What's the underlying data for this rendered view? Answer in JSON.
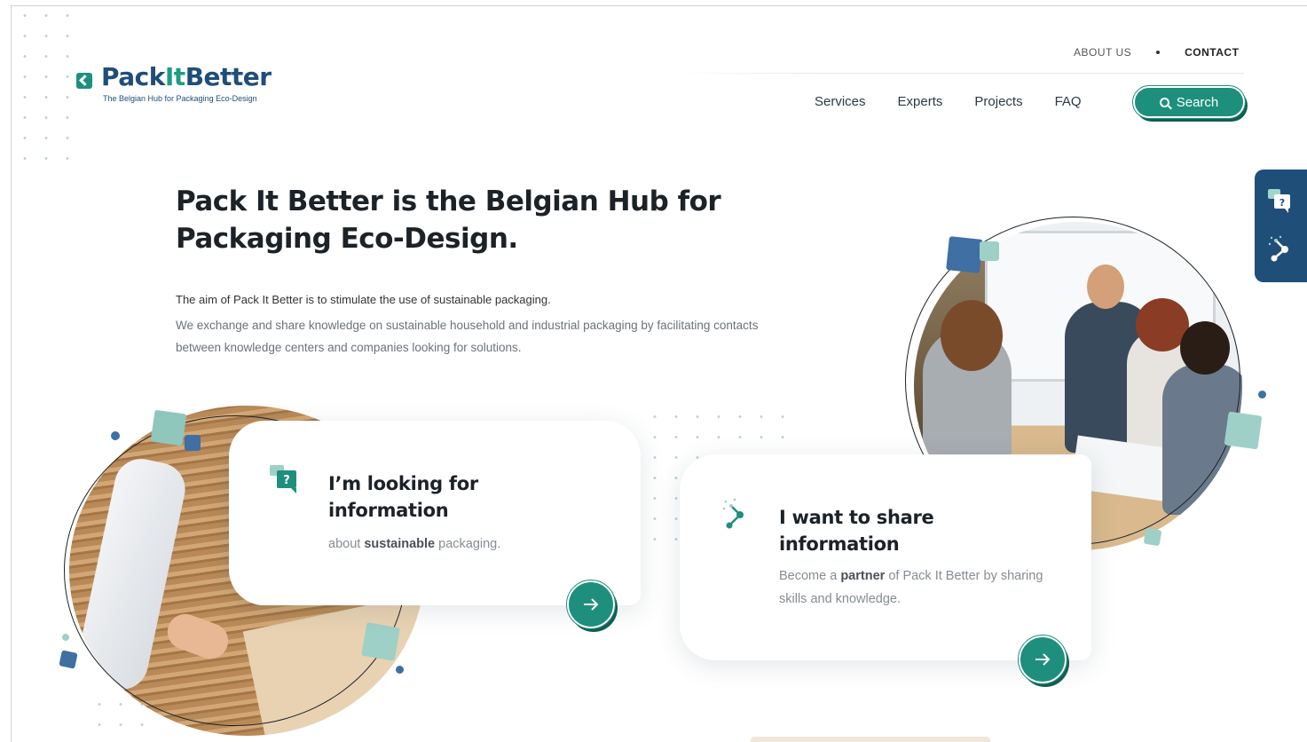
{
  "brand": {
    "name_part1": "Pack",
    "name_part2": "It",
    "name_part3": "Better",
    "tagline": "The Belgian Hub for Packaging Eco-Design",
    "primary_color": "#1f4e79",
    "accent_color": "#1e8f7c"
  },
  "topnav": {
    "about": "ABOUT US",
    "contact": "CONTACT"
  },
  "mainnav": {
    "items": [
      "Services",
      "Experts",
      "Projects",
      "FAQ"
    ],
    "search_label": "Search"
  },
  "side_widget": {
    "icons": [
      "question-chat-icon",
      "share-nodes-icon"
    ]
  },
  "hero": {
    "title": "Pack It Better is the Belgian Hub for Packaging Eco-Design.",
    "lead": "The aim of Pack It Better is to stimulate the use of sustainable packaging.",
    "body": "We exchange and share knowledge on sustainable household and industrial packaging by facilitating contacts between knowledge centers and companies looking for solutions."
  },
  "cards": [
    {
      "title": "I’m looking for information",
      "text_before": "about ",
      "text_bold": "sustainable",
      "text_after": " packaging.",
      "icon": "question-chat-icon"
    },
    {
      "title": "I want to share information",
      "text_before": "Become a ",
      "text_bold": "partner",
      "text_after": " of Pack It Better by sharing skills and knowledge.",
      "icon": "share-nodes-icon"
    }
  ]
}
